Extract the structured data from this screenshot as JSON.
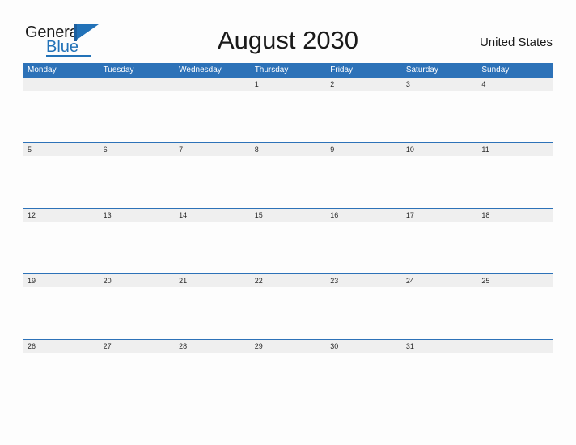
{
  "branding": {
    "name_part1": "General",
    "name_part2": "Blue",
    "flag_icon": "blue-triangle-flag-icon"
  },
  "header": {
    "title": "August 2030",
    "region": "United States"
  },
  "colors": {
    "header_blue": "#2d72b8",
    "band_gray": "#efefef",
    "page_background": "#fdfdfd",
    "text_dark": "#1a1a1a",
    "text_white": "#ffffff"
  },
  "calendar": {
    "month": "August",
    "year": "2030",
    "weekday_headers": [
      "Monday",
      "Tuesday",
      "Wednesday",
      "Thursday",
      "Friday",
      "Saturday",
      "Sunday"
    ],
    "weeks": [
      [
        "",
        "",
        "",
        "1",
        "2",
        "3",
        "4"
      ],
      [
        "5",
        "6",
        "7",
        "8",
        "9",
        "10",
        "11"
      ],
      [
        "12",
        "13",
        "14",
        "15",
        "16",
        "17",
        "18"
      ],
      [
        "19",
        "20",
        "21",
        "22",
        "23",
        "24",
        "25"
      ],
      [
        "26",
        "27",
        "28",
        "29",
        "30",
        "31",
        ""
      ]
    ]
  }
}
